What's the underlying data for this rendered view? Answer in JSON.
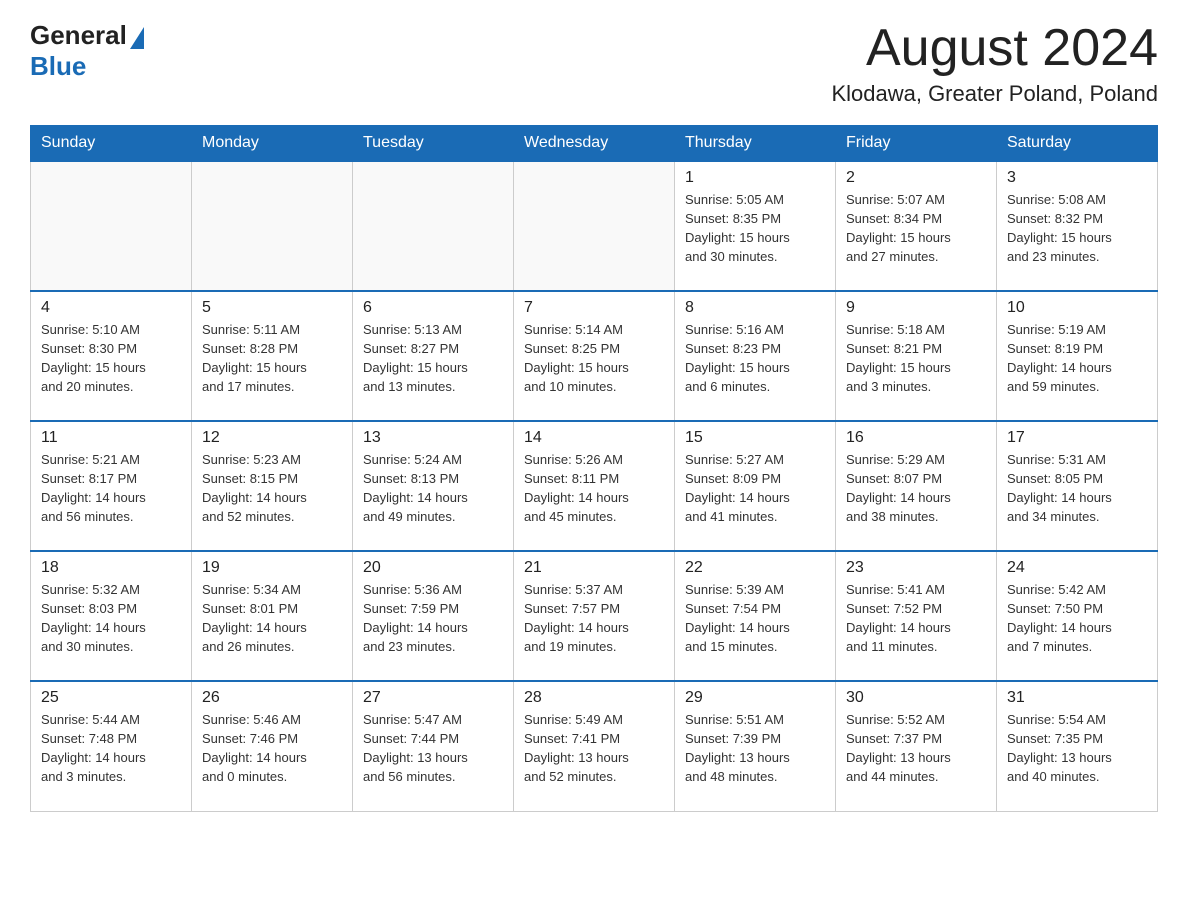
{
  "header": {
    "logo_general": "General",
    "logo_blue": "Blue",
    "month_title": "August 2024",
    "location": "Klodawa, Greater Poland, Poland"
  },
  "weekdays": [
    "Sunday",
    "Monday",
    "Tuesday",
    "Wednesday",
    "Thursday",
    "Friday",
    "Saturday"
  ],
  "weeks": [
    [
      {
        "day": "",
        "info": ""
      },
      {
        "day": "",
        "info": ""
      },
      {
        "day": "",
        "info": ""
      },
      {
        "day": "",
        "info": ""
      },
      {
        "day": "1",
        "info": "Sunrise: 5:05 AM\nSunset: 8:35 PM\nDaylight: 15 hours\nand 30 minutes."
      },
      {
        "day": "2",
        "info": "Sunrise: 5:07 AM\nSunset: 8:34 PM\nDaylight: 15 hours\nand 27 minutes."
      },
      {
        "day": "3",
        "info": "Sunrise: 5:08 AM\nSunset: 8:32 PM\nDaylight: 15 hours\nand 23 minutes."
      }
    ],
    [
      {
        "day": "4",
        "info": "Sunrise: 5:10 AM\nSunset: 8:30 PM\nDaylight: 15 hours\nand 20 minutes."
      },
      {
        "day": "5",
        "info": "Sunrise: 5:11 AM\nSunset: 8:28 PM\nDaylight: 15 hours\nand 17 minutes."
      },
      {
        "day": "6",
        "info": "Sunrise: 5:13 AM\nSunset: 8:27 PM\nDaylight: 15 hours\nand 13 minutes."
      },
      {
        "day": "7",
        "info": "Sunrise: 5:14 AM\nSunset: 8:25 PM\nDaylight: 15 hours\nand 10 minutes."
      },
      {
        "day": "8",
        "info": "Sunrise: 5:16 AM\nSunset: 8:23 PM\nDaylight: 15 hours\nand 6 minutes."
      },
      {
        "day": "9",
        "info": "Sunrise: 5:18 AM\nSunset: 8:21 PM\nDaylight: 15 hours\nand 3 minutes."
      },
      {
        "day": "10",
        "info": "Sunrise: 5:19 AM\nSunset: 8:19 PM\nDaylight: 14 hours\nand 59 minutes."
      }
    ],
    [
      {
        "day": "11",
        "info": "Sunrise: 5:21 AM\nSunset: 8:17 PM\nDaylight: 14 hours\nand 56 minutes."
      },
      {
        "day": "12",
        "info": "Sunrise: 5:23 AM\nSunset: 8:15 PM\nDaylight: 14 hours\nand 52 minutes."
      },
      {
        "day": "13",
        "info": "Sunrise: 5:24 AM\nSunset: 8:13 PM\nDaylight: 14 hours\nand 49 minutes."
      },
      {
        "day": "14",
        "info": "Sunrise: 5:26 AM\nSunset: 8:11 PM\nDaylight: 14 hours\nand 45 minutes."
      },
      {
        "day": "15",
        "info": "Sunrise: 5:27 AM\nSunset: 8:09 PM\nDaylight: 14 hours\nand 41 minutes."
      },
      {
        "day": "16",
        "info": "Sunrise: 5:29 AM\nSunset: 8:07 PM\nDaylight: 14 hours\nand 38 minutes."
      },
      {
        "day": "17",
        "info": "Sunrise: 5:31 AM\nSunset: 8:05 PM\nDaylight: 14 hours\nand 34 minutes."
      }
    ],
    [
      {
        "day": "18",
        "info": "Sunrise: 5:32 AM\nSunset: 8:03 PM\nDaylight: 14 hours\nand 30 minutes."
      },
      {
        "day": "19",
        "info": "Sunrise: 5:34 AM\nSunset: 8:01 PM\nDaylight: 14 hours\nand 26 minutes."
      },
      {
        "day": "20",
        "info": "Sunrise: 5:36 AM\nSunset: 7:59 PM\nDaylight: 14 hours\nand 23 minutes."
      },
      {
        "day": "21",
        "info": "Sunrise: 5:37 AM\nSunset: 7:57 PM\nDaylight: 14 hours\nand 19 minutes."
      },
      {
        "day": "22",
        "info": "Sunrise: 5:39 AM\nSunset: 7:54 PM\nDaylight: 14 hours\nand 15 minutes."
      },
      {
        "day": "23",
        "info": "Sunrise: 5:41 AM\nSunset: 7:52 PM\nDaylight: 14 hours\nand 11 minutes."
      },
      {
        "day": "24",
        "info": "Sunrise: 5:42 AM\nSunset: 7:50 PM\nDaylight: 14 hours\nand 7 minutes."
      }
    ],
    [
      {
        "day": "25",
        "info": "Sunrise: 5:44 AM\nSunset: 7:48 PM\nDaylight: 14 hours\nand 3 minutes."
      },
      {
        "day": "26",
        "info": "Sunrise: 5:46 AM\nSunset: 7:46 PM\nDaylight: 14 hours\nand 0 minutes."
      },
      {
        "day": "27",
        "info": "Sunrise: 5:47 AM\nSunset: 7:44 PM\nDaylight: 13 hours\nand 56 minutes."
      },
      {
        "day": "28",
        "info": "Sunrise: 5:49 AM\nSunset: 7:41 PM\nDaylight: 13 hours\nand 52 minutes."
      },
      {
        "day": "29",
        "info": "Sunrise: 5:51 AM\nSunset: 7:39 PM\nDaylight: 13 hours\nand 48 minutes."
      },
      {
        "day": "30",
        "info": "Sunrise: 5:52 AM\nSunset: 7:37 PM\nDaylight: 13 hours\nand 44 minutes."
      },
      {
        "day": "31",
        "info": "Sunrise: 5:54 AM\nSunset: 7:35 PM\nDaylight: 13 hours\nand 40 minutes."
      }
    ]
  ]
}
